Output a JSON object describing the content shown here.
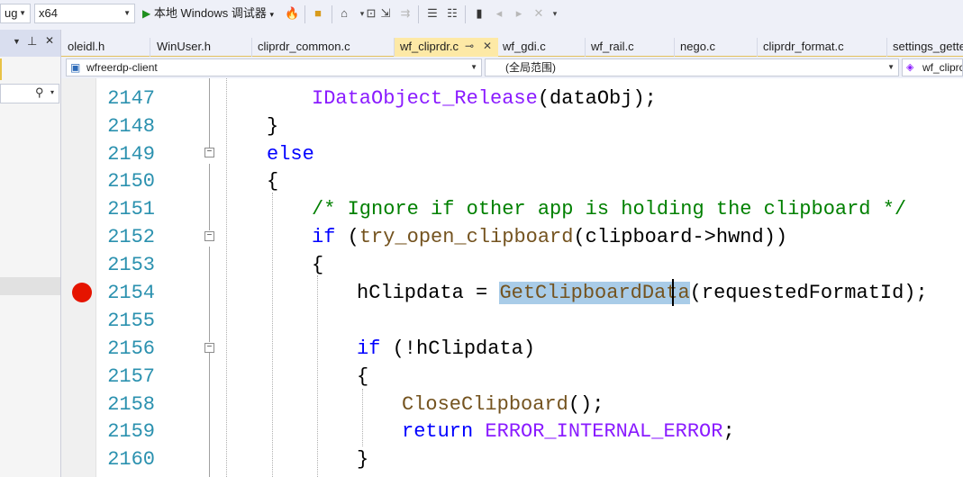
{
  "toolbar": {
    "config_value": "ug",
    "platform_value": "x64",
    "run_label": "本地 Windows 调试器",
    "run_dropdown": "▾"
  },
  "tabs": [
    {
      "label": "oleidl.h"
    },
    {
      "label": "WinUser.h"
    },
    {
      "label": "cliprdr_common.c"
    },
    {
      "label": "wf_cliprdr.c",
      "active": true
    },
    {
      "label": "wf_gdi.c"
    },
    {
      "label": "wf_rail.c"
    },
    {
      "label": "nego.c"
    },
    {
      "label": "cliprdr_format.c"
    },
    {
      "label": "settings_gette"
    }
  ],
  "tab_pin": "⊸",
  "tab_close": "✕",
  "navbar": {
    "project": "wfreerdp-client",
    "scope": "(全局范围)",
    "member": "wf_cliprc"
  },
  "editor": {
    "lines": [
      {
        "num": "2147",
        "tokens": [
          {
            "t": "IDataObject_Release",
            "c": "mac"
          },
          {
            "t": "(dataObj);",
            "c": ""
          }
        ]
      },
      {
        "num": "2148",
        "tokens": [
          {
            "t": "}",
            "c": ""
          }
        ]
      },
      {
        "num": "2149",
        "tokens": [
          {
            "t": "else",
            "c": "kw"
          }
        ]
      },
      {
        "num": "2150",
        "tokens": [
          {
            "t": "{",
            "c": ""
          }
        ]
      },
      {
        "num": "2151",
        "tokens": [
          {
            "t": "/* Ignore if other app is holding the clipboard */",
            "c": "cm"
          }
        ]
      },
      {
        "num": "2152",
        "tokens": [
          {
            "t": "if",
            "c": "kw"
          },
          {
            "t": " (",
            "c": ""
          },
          {
            "t": "try_open_clipboard",
            "c": "fn"
          },
          {
            "t": "(clipboard->hwnd))",
            "c": ""
          }
        ]
      },
      {
        "num": "2153",
        "tokens": [
          {
            "t": "{",
            "c": ""
          }
        ]
      },
      {
        "num": "2154",
        "tokens": [
          {
            "t": "hClipdata = ",
            "c": ""
          },
          {
            "t": "GetClipboardData",
            "c": "hl"
          },
          {
            "t": "(requestedFormatId);",
            "c": ""
          }
        ]
      },
      {
        "num": "2155",
        "tokens": []
      },
      {
        "num": "2156",
        "tokens": [
          {
            "t": "if",
            "c": "kw"
          },
          {
            "t": " (!hClipdata)",
            "c": ""
          }
        ]
      },
      {
        "num": "2157",
        "tokens": [
          {
            "t": "{",
            "c": ""
          }
        ]
      },
      {
        "num": "2158",
        "tokens": [
          {
            "t": "CloseClipboard",
            "c": "fn"
          },
          {
            "t": "();",
            "c": ""
          }
        ]
      },
      {
        "num": "2159",
        "tokens": [
          {
            "t": "return",
            "c": "kw"
          },
          {
            "t": " ",
            "c": ""
          },
          {
            "t": "ERROR_INTERNAL_ERROR",
            "c": "mac"
          },
          {
            "t": ";",
            "c": ""
          }
        ]
      },
      {
        "num": "2160",
        "tokens": [
          {
            "t": "}",
            "c": ""
          }
        ]
      }
    ]
  },
  "colors": {
    "keyword": "#0000ff",
    "function": "#74531f",
    "macro": "#8a1bff",
    "comment": "#008000",
    "line_number": "#2b91af",
    "breakpoint": "#e51400",
    "active_tab": "#fde9a6"
  },
  "breakpoint_line": "2154"
}
